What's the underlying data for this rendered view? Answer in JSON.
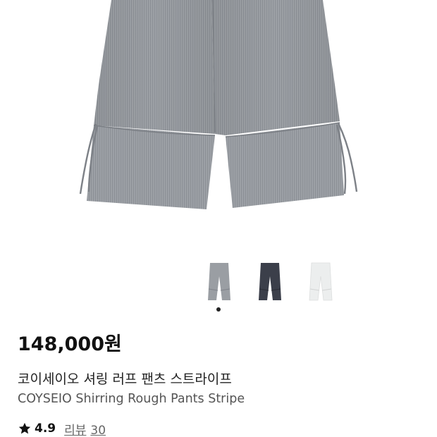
{
  "product": {
    "price": "148,000원",
    "name_ko": "코이세이오 셔링 러프 팬츠 스트라이프",
    "name_en": "COYSEIO Shirring Rough Pants Stripe",
    "rating": "4.9",
    "review_label": "리뷰",
    "review_count": "30"
  },
  "gallery": {
    "hero_image": "striped-gray-wide-pants",
    "swatches": [
      {
        "name": "stripe-gray",
        "color": "#9a9ea3",
        "selected": true
      },
      {
        "name": "charcoal-navy",
        "color": "#3b3f4a",
        "selected": false
      },
      {
        "name": "white",
        "color": "#eceeee",
        "selected": false
      }
    ],
    "active_index": 1,
    "total": 3
  },
  "colors": {
    "text_primary": "#111111",
    "text_secondary": "#555555",
    "link": "#666666"
  },
  "icons": {
    "star": "star-icon"
  }
}
